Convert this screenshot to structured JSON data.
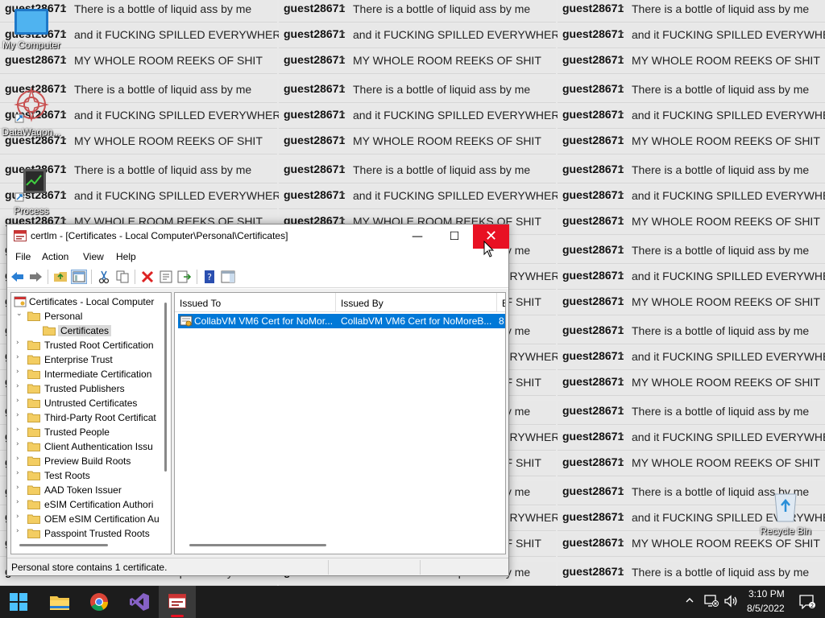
{
  "wallpaper": {
    "username": "guest28671",
    "messages": [
      "There is a bottle of liquid ass by me",
      "and it FUCKING SPILLED EVERYWHERE",
      "MY WHOLE ROOM REEKS OF SHIT"
    ]
  },
  "desktop_icons": [
    {
      "label": "My Computer"
    },
    {
      "label": "DataWagon..."
    },
    {
      "label": "Process"
    },
    {
      "label": "Recycle Bin"
    }
  ],
  "window": {
    "title": "certlm - [Certificates - Local Computer\\Personal\\Certificates]",
    "menu": [
      "File",
      "Action",
      "View",
      "Help"
    ]
  },
  "tree": {
    "root": "Certificates - Local Computer",
    "personal": "Personal",
    "certificates": "Certificates",
    "stores": [
      "Trusted Root Certification",
      "Enterprise Trust",
      "Intermediate Certification",
      "Trusted Publishers",
      "Untrusted Certificates",
      "Third-Party Root Certificat",
      "Trusted People",
      "Client Authentication Issu",
      "Preview Build Roots",
      "Test Roots",
      "AAD Token Issuer",
      "eSIM Certification Authori",
      "OEM eSIM Certification Au",
      "Passpoint Trusted Roots"
    ]
  },
  "list": {
    "columns": [
      "Issued To",
      "Issued By",
      "E"
    ],
    "rows": [
      {
        "issued_to": "CollabVM VM6 Cert for NoMor...",
        "issued_by": "CollabVM VM6 Cert for NoMoreB...",
        "expiration": "8"
      }
    ]
  },
  "status": {
    "text": "Personal store contains 1 certificate."
  },
  "taskbar": {
    "time": "3:10 PM",
    "date": "8/5/2022"
  },
  "colors": {
    "selection": "#0078d7",
    "close_hover": "#e81123",
    "taskbar": "#1c1c1c"
  }
}
